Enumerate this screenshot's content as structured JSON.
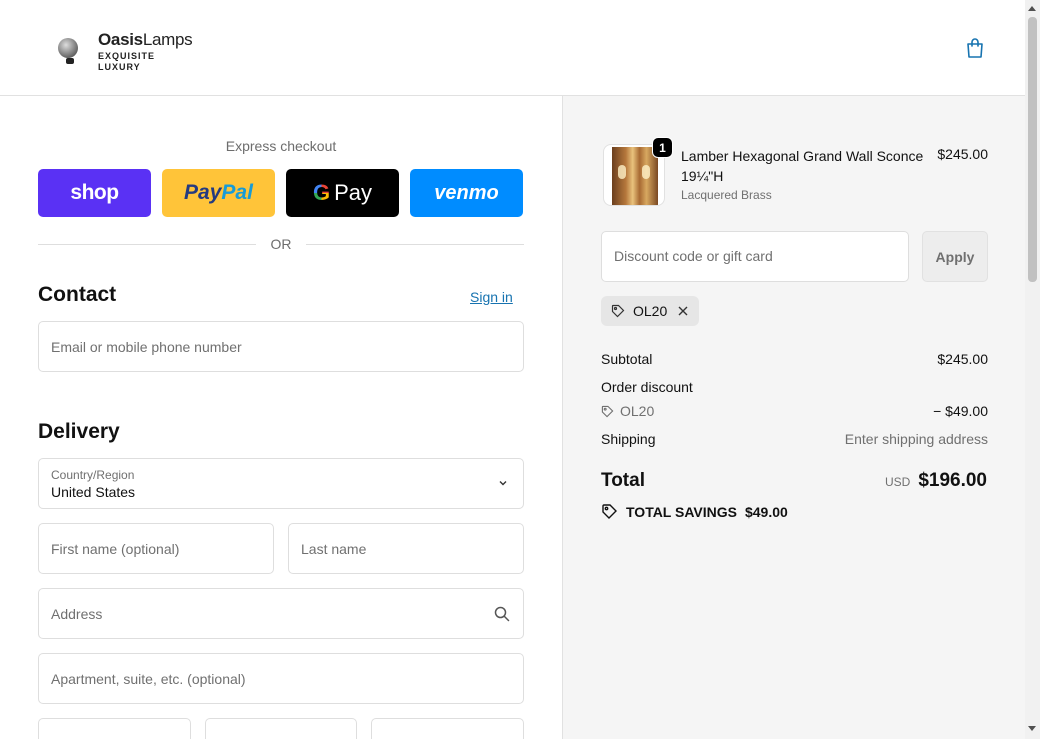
{
  "header": {
    "brand_bold": "Oasis",
    "brand_light": "Lamps",
    "tagline_1": "EXQUISITE",
    "tagline_2": "LUXURY",
    "cart_icon": "shopping-bag-icon"
  },
  "express": {
    "title": "Express checkout",
    "shop_label": "shop",
    "paypal_part1": "Pay",
    "paypal_part2": "Pal",
    "gpay_g": "G",
    "gpay_label": "Pay",
    "venmo_label": "venmo",
    "or_label": "OR"
  },
  "contact": {
    "title": "Contact",
    "sign_in": "Sign in",
    "email_placeholder": "Email or mobile phone number"
  },
  "delivery": {
    "title": "Delivery",
    "country_label": "Country/Region",
    "country_value": "United States",
    "first_name_placeholder": "First name (optional)",
    "last_name_placeholder": "Last name",
    "address_placeholder": "Address",
    "apartment_placeholder": "Apartment, suite, etc. (optional)"
  },
  "summary": {
    "item": {
      "quantity": "1",
      "name": "Lamber Hexagonal Grand Wall Sconce 19¼\"H",
      "variant": "Lacquered Brass",
      "price": "$245.00"
    },
    "discount_placeholder": "Discount code or gift card",
    "apply_label": "Apply",
    "applied_code": "OL20",
    "subtotal_label": "Subtotal",
    "subtotal_value": "$245.00",
    "order_discount_label": "Order discount",
    "discount_code": "OL20",
    "discount_value": "− $49.00",
    "shipping_label": "Shipping",
    "shipping_value": "Enter shipping address",
    "total_label": "Total",
    "currency": "USD",
    "total_value": "$196.00",
    "savings_label": "TOTAL SAVINGS",
    "savings_value": "$49.00"
  },
  "colors": {
    "shop": "#5a31f4",
    "paypal": "#ffc439",
    "gpay": "#000000",
    "venmo": "#008cff",
    "link": "#1773b0"
  }
}
